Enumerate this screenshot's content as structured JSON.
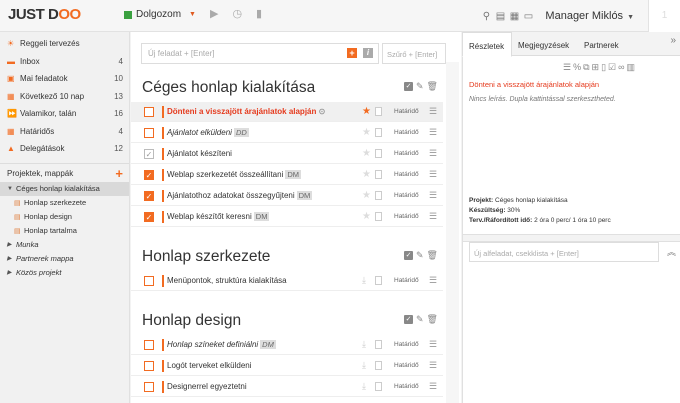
{
  "app": {
    "logo_part1": "JUST D",
    "logo_part2": "OO",
    "timer_label": "Dolgozom",
    "user": "Manager Miklós"
  },
  "colors": {
    "accent": "#f26b21",
    "red_text": "#e53a1d",
    "timer_green": "#3aa040"
  },
  "sidebar": {
    "items": [
      {
        "label": "Reggeli tervezés",
        "count": "",
        "icon": "sun-icon",
        "glyph": "☀"
      },
      {
        "label": "Inbox",
        "count": "4",
        "icon": "inbox-icon",
        "glyph": "▬"
      },
      {
        "label": "Mai feladatok",
        "count": "10",
        "icon": "today-icon",
        "glyph": "▣"
      },
      {
        "label": "Következő 10 nap",
        "count": "13",
        "icon": "calendar-icon",
        "glyph": "▦"
      },
      {
        "label": "Valamikor, talán",
        "count": "16",
        "icon": "fast-forward-icon",
        "glyph": "⏩"
      },
      {
        "label": "Határidős",
        "count": "4",
        "icon": "deadline-icon",
        "glyph": "▦"
      },
      {
        "label": "Delegátások",
        "count": "12",
        "icon": "delegation-icon",
        "glyph": "▲"
      }
    ],
    "projects_label": "Projektek, mappák",
    "projects": [
      {
        "label": "Céges honlap kialakítása",
        "type": "project"
      },
      {
        "label": "Honlap szerkezete",
        "type": "sub"
      },
      {
        "label": "Honlap design",
        "type": "sub"
      },
      {
        "label": "Honlap tartalma",
        "type": "sub"
      },
      {
        "label": "Munka",
        "type": "folder"
      },
      {
        "label": "Partnerek mappa",
        "type": "folder"
      },
      {
        "label": "Közös projekt",
        "type": "folder"
      }
    ]
  },
  "main": {
    "new_task_placeholder": "Új feladat + [Enter]",
    "filter_placeholder": "Szűrő + [Enter]",
    "due_label": "Határidő",
    "sections": [
      {
        "title": "Céges honlap kialakítása",
        "tasks": [
          {
            "text": "Dönteni a visszajött árajánlatok alapján",
            "tag": "",
            "style": "red",
            "check": "empty",
            "star": "on",
            "highlight": true
          },
          {
            "text": "Ajánlatot elkülden​i",
            "tag": "DD",
            "style": "italic",
            "check": "empty",
            "star": "off"
          },
          {
            "text": "Ajánlatot készíteni",
            "tag": "",
            "style": "normal",
            "check": "grey",
            "star": "off"
          },
          {
            "text": "Weblap szerkezetét összeállítani",
            "tag": "DM",
            "style": "normal",
            "check": "on",
            "star": "off"
          },
          {
            "text": "Ajánlatothoz adatokat összegyűjteni",
            "tag": "DM",
            "style": "normal",
            "check": "on",
            "star": "off"
          },
          {
            "text": "Weblap készítőt keresni",
            "tag": "DM",
            "style": "normal",
            "check": "on",
            "star": "off"
          }
        ]
      },
      {
        "title": "Honlap szerkezete",
        "tasks": [
          {
            "text": "Menüpontok, struktúra kialakítása",
            "tag": "",
            "style": "normal",
            "check": "empty",
            "star": "dl"
          }
        ]
      },
      {
        "title": "Honlap design",
        "tasks": [
          {
            "text": "Honlap színeket definiálni",
            "tag": "DM",
            "style": "italic",
            "check": "empty",
            "star": "dl"
          },
          {
            "text": "Logót terveket elküldeni",
            "tag": "",
            "style": "normal",
            "check": "empty",
            "star": "dl"
          },
          {
            "text": "Designerrel egyeztetni",
            "tag": "",
            "style": "normal",
            "check": "empty",
            "star": "dl"
          }
        ]
      }
    ]
  },
  "details": {
    "tabs": [
      "Részletek",
      "Megjegyzések",
      "Partnerek"
    ],
    "title": "Dönteni a visszajött árajánlatok alapján",
    "description": "Nincs leírás. Dupla kattintással szerkesztheted.",
    "project_label": "Projekt:",
    "project_value": "Céges honlap kialakítása",
    "progress_label": "Készültség:",
    "progress_value": "30%",
    "time_label": "Terv./Ráfordított idő:",
    "time_value": "2 óra 0 perc/ 1 óra 10 perc",
    "subtask_placeholder": "Új alfeladat, csekklista + [Enter]"
  }
}
